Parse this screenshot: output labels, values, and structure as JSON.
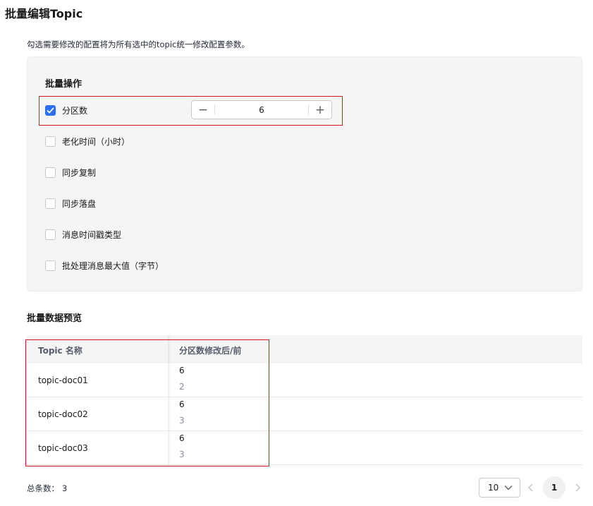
{
  "page": {
    "title": "批量编辑Topic",
    "description": "勾选需要修改的配置将为所有选中的topic统一修改配置参数。"
  },
  "batch_ops": {
    "title": "批量操作",
    "options": [
      {
        "label": "分区数",
        "checked": true
      },
      {
        "label": "老化时间（小时）",
        "checked": false
      },
      {
        "label": "同步复制",
        "checked": false
      },
      {
        "label": "同步落盘",
        "checked": false
      },
      {
        "label": "消息时间戳类型",
        "checked": false
      },
      {
        "label": "批处理消息最大值（字节）",
        "checked": false
      }
    ],
    "partition_value": "6",
    "minus": "−",
    "plus": "+"
  },
  "preview": {
    "title": "批量数据预览",
    "columns": [
      "Topic 名称",
      "分区数修改后/前"
    ],
    "rows": [
      {
        "name": "topic-doc01",
        "new": "6",
        "old": "2"
      },
      {
        "name": "topic-doc02",
        "new": "6",
        "old": "3"
      },
      {
        "name": "topic-doc03",
        "new": "6",
        "old": "3"
      }
    ]
  },
  "footer": {
    "total_label": "总条数：",
    "total_count": "3",
    "page_size": "10",
    "current_page": "1"
  },
  "colors": {
    "primary": "#2e6ff2",
    "highlight": "#d9161d",
    "panel_bg": "#f5f5f6"
  }
}
